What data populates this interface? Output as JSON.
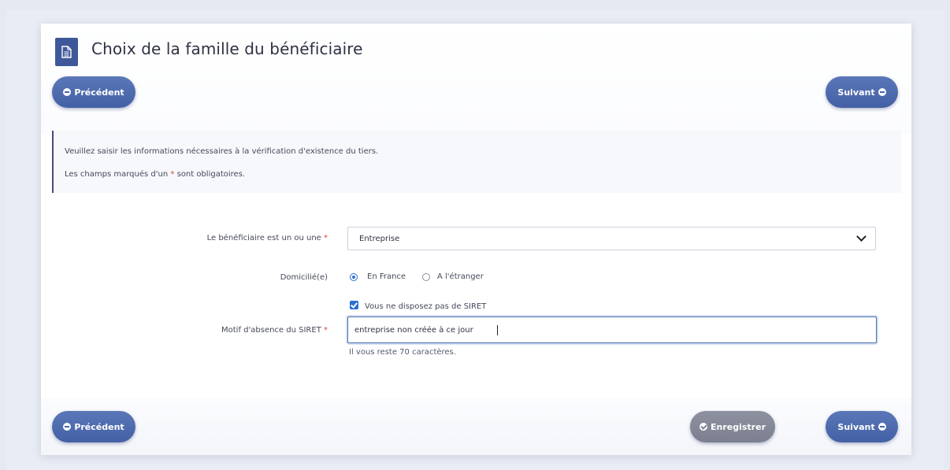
{
  "page": {
    "title": "Choix de la famille du bénéficiaire",
    "title_icon": "document-icon"
  },
  "nav": {
    "previous_label": "Précédent",
    "next_label": "Suivant",
    "save_label": "Enregistrer"
  },
  "info": {
    "line1": "Veuillez saisir les informations nécessaires à la vérification d'existence du tiers.",
    "line2_before": "Les champs marqués d'un",
    "line2_star": "*",
    "line2_after": "sont obligatoires."
  },
  "form": {
    "type_label": "Le bénéficiaire est un ou une",
    "type_value": "Entreprise",
    "domicile_label": "Domicilié(e)",
    "domicile_options": [
      {
        "label": "En France",
        "selected": true
      },
      {
        "label": "A l'étranger",
        "selected": false
      }
    ],
    "no_siret_label": "Vous ne disposez pas de SIRET",
    "no_siret_checked": true,
    "motif_label": "Motif d'absence du SIRET",
    "motif_value": "entreprise non créée à ce jour",
    "motif_helper": "Il vous reste 70 caractères.",
    "required_mark": "*"
  },
  "colors": {
    "primary_button": "#4a66aa",
    "disabled_button": "#848898",
    "required": "#d8453c",
    "accent": "#2b6fd6"
  }
}
